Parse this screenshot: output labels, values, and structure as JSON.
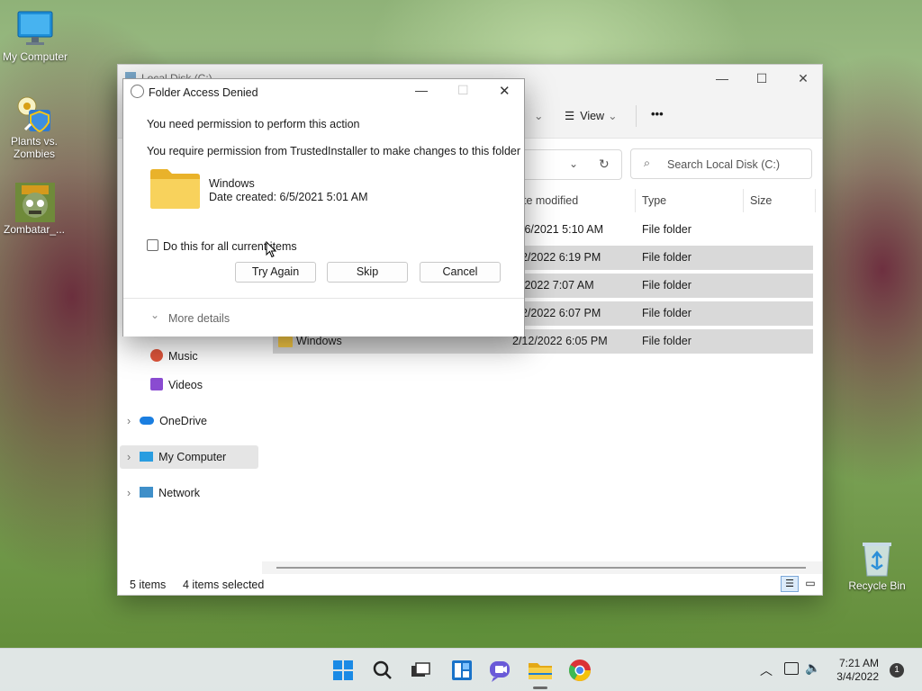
{
  "desktop": {
    "icons": [
      {
        "label": "My Computer"
      },
      {
        "label": "Plants vs. Zombies"
      },
      {
        "label": "Zombatar_..."
      },
      {
        "label": "Recycle Bin"
      }
    ]
  },
  "explorer": {
    "title": "Local Disk (C:)",
    "toolbar": {
      "view_label": "View",
      "more_label": "•••"
    },
    "search_placeholder": "Search Local Disk (C:)",
    "columns": {
      "date": "te modified",
      "type": "Type",
      "size": "Size"
    },
    "rows": [
      {
        "name": "",
        "date": "/6/2021 5:10 AM",
        "type": "File folder",
        "selected": false
      },
      {
        "name": "",
        "date": "2/2022 6:19 PM",
        "type": "File folder",
        "selected": true
      },
      {
        "name": "",
        "date": "/2022 7:07 AM",
        "type": "File folder",
        "selected": true
      },
      {
        "name": "",
        "date": "2/2022 6:07 PM",
        "type": "File folder",
        "selected": true
      },
      {
        "name": "Windows",
        "date": "2/12/2022 6:05 PM",
        "type": "File folder",
        "selected": true
      }
    ],
    "nav": {
      "music": "Music",
      "videos": "Videos",
      "onedrive": "OneDrive",
      "mycomputer": "My Computer",
      "network": "Network"
    },
    "status": {
      "items": "5 items",
      "selected": "4 items selected"
    }
  },
  "dialog": {
    "title": "Folder Access Denied",
    "line1": "You need permission to perform this action",
    "line2": "You require permission from TrustedInstaller to make changes to this folder",
    "folder_name": "Windows",
    "folder_date": "Date created: 6/5/2021 5:01 AM",
    "checkbox_label": "Do this for all current items",
    "try_again": "Try Again",
    "skip": "Skip",
    "cancel": "Cancel",
    "more_details": "More details"
  },
  "taskbar": {
    "time": "7:21 AM",
    "date": "3/4/2022",
    "notification_count": "1"
  },
  "colors": {
    "accent": "#0067c0",
    "folder": "#f6c945",
    "selection": "#d9d9d9"
  }
}
